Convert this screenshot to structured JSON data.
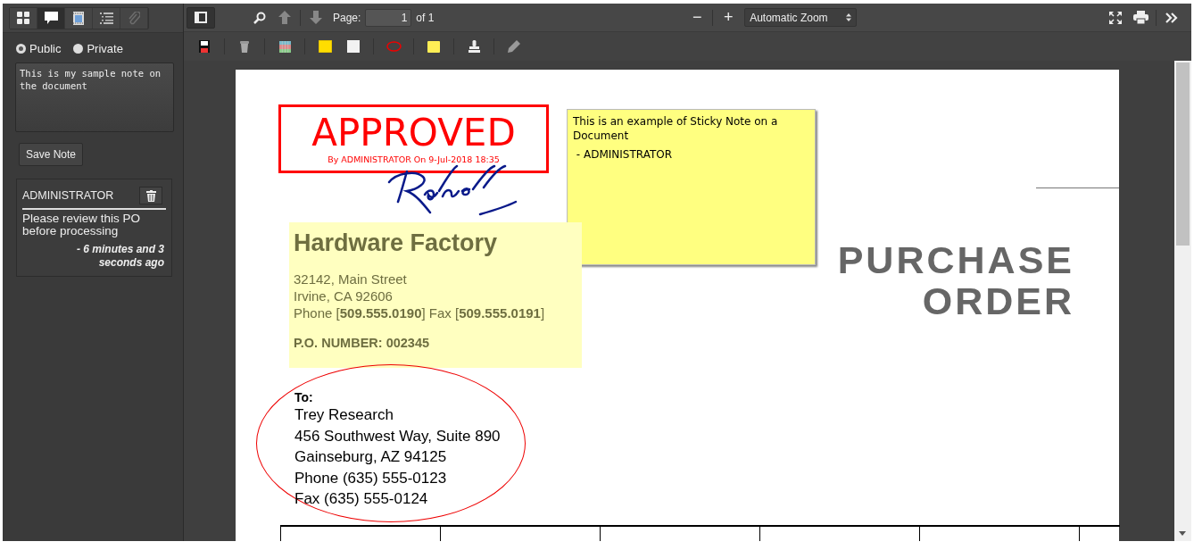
{
  "sidebar": {
    "tabs": [
      {
        "kind": "thumbnails",
        "selected": false,
        "disabled": false
      },
      {
        "kind": "comments",
        "selected": true,
        "disabled": false
      },
      {
        "kind": "document",
        "selected": false,
        "disabled": false
      },
      {
        "kind": "outline",
        "selected": false,
        "disabled": false
      },
      {
        "kind": "attachments",
        "selected": false,
        "disabled": true
      }
    ],
    "visibility": [
      {
        "label": "Public",
        "selected": true
      },
      {
        "label": "Private",
        "selected": false
      }
    ],
    "note_field": {
      "value": "This is my sample note on the document"
    },
    "save_button": "Save Note",
    "comments": [
      {
        "author": "ADMINISTRATOR",
        "text": "Please review this PO before processing",
        "time": "- 6 minutes and 3 seconds ago"
      }
    ]
  },
  "toolbar": {
    "page_label": "Page:",
    "page_value": "1",
    "page_total": "of 1",
    "zoom": "Automatic Zoom",
    "zoom_out": "−",
    "zoom_in": "+"
  },
  "document": {
    "stamp": {
      "title": "APPROVED",
      "caption": "By ADMINISTRATOR On 9-Jul-2018 18:35"
    },
    "sticky_note": {
      "lines": [
        "This is an example of Sticky Note on a Document",
        " - ADMINISTRATOR"
      ]
    },
    "company": {
      "name": "Hardware Factory",
      "address": [
        "32142, Main Street",
        "Irvine, CA 92606"
      ],
      "phone_line": "Phone [**509.555.0190**]  Fax [**509.555.0191**]",
      "po_number": "P.O. NUMBER: 002345"
    },
    "title": [
      "PURCHASE",
      "ORDER"
    ],
    "recipient": {
      "heading": "To:",
      "lines": [
        "Trey Research",
        "456 Southwest Way, Suite 890",
        "Gainseburg, AZ 94125",
        "Phone (635) 555-0123",
        "Fax (635) 555-0124"
      ]
    }
  }
}
